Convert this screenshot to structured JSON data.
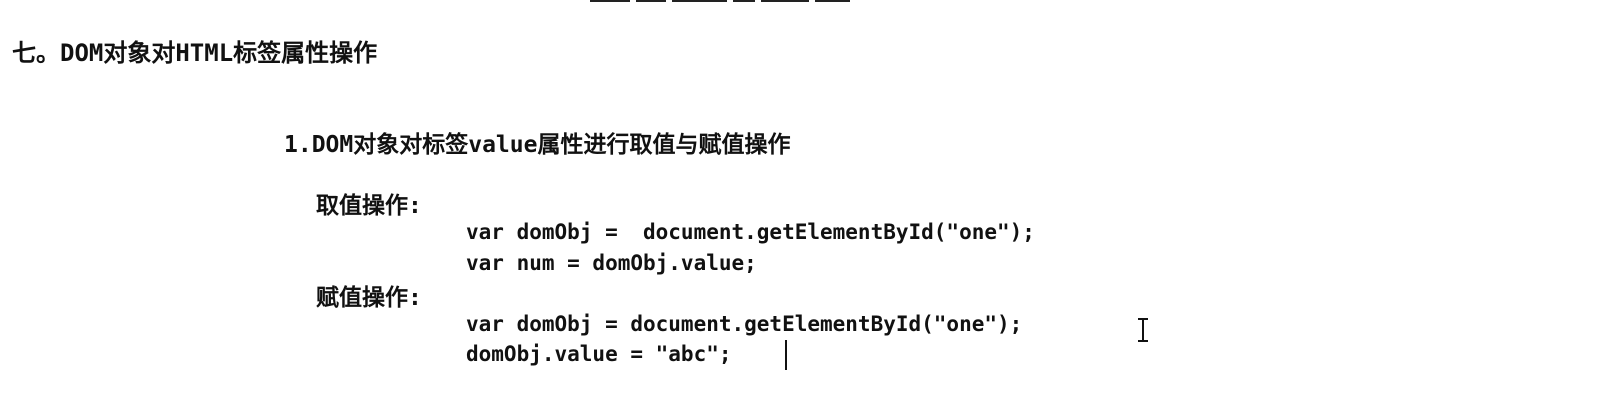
{
  "section": {
    "heading": "七。DOM对象对HTML标签属性操作"
  },
  "subsection": {
    "heading": "1.DOM对象对标签value属性进行取值与赋值操作"
  },
  "get_block": {
    "label": "取值操作:",
    "lines": [
      "var domObj =  document.getElementById(\"one\");",
      "var num = domObj.value;"
    ]
  },
  "set_block": {
    "label": "赋值操作:",
    "lines": [
      "var domObj = document.getElementById(\"one\");",
      "domObj.value = \"abc\";"
    ]
  }
}
